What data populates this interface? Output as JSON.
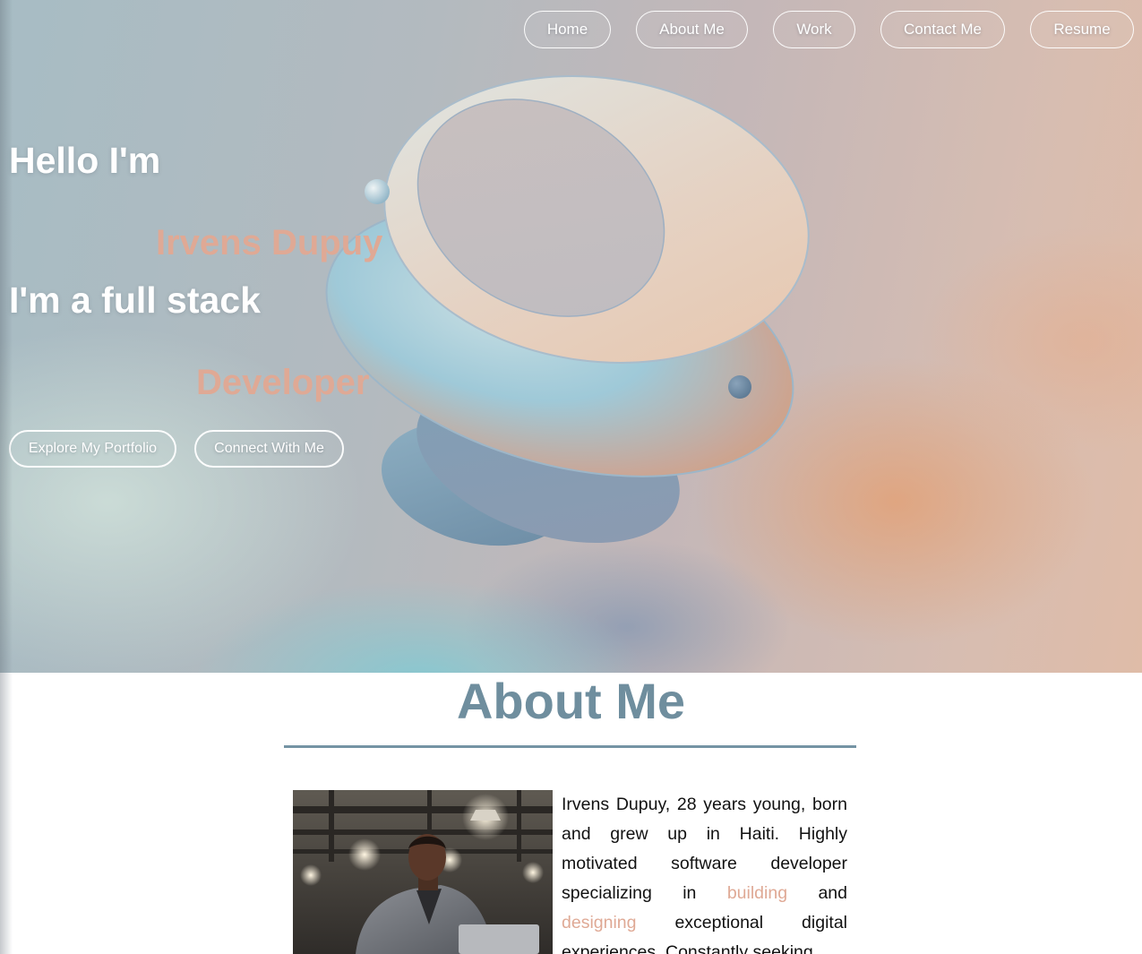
{
  "nav": {
    "items": [
      {
        "label": "Home"
      },
      {
        "label": "About Me"
      },
      {
        "label": "Work"
      },
      {
        "label": "Contact Me"
      },
      {
        "label": "Resume"
      }
    ]
  },
  "hero": {
    "greeting": "Hello I'm",
    "name": "Irvens Dupuy",
    "role_prefix": "I'm a full stack",
    "role": "Developer",
    "buttons": {
      "portfolio": "Explore My Portfolio",
      "connect": "Connect With Me"
    }
  },
  "about": {
    "title": "About Me",
    "bio_part1": "Irvens Dupuy, 28 years young, born and grew up in Haiti. Highly motivated software developer specializing in ",
    "bio_accent1": "building",
    "bio_part2": " and ",
    "bio_accent2": "designing",
    "bio_part3": " exceptional digital experiences. Constantly seeking"
  },
  "colors": {
    "accent": "#dfa995",
    "heading": "#6f8e9e",
    "rule": "#7594a4"
  }
}
